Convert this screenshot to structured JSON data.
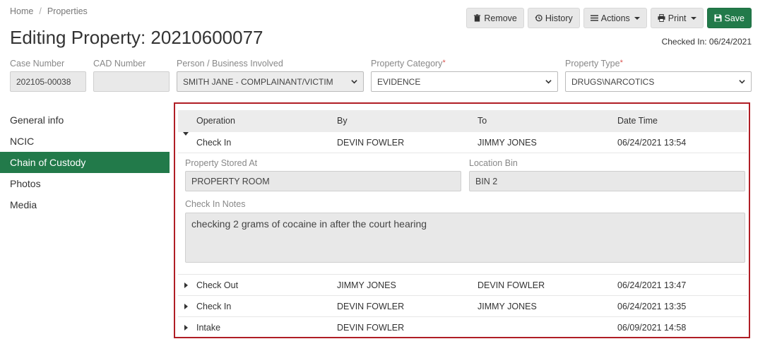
{
  "breadcrumb": {
    "home": "Home",
    "separator": "/",
    "current": "Properties"
  },
  "page": {
    "title": "Editing Property: 20210600077",
    "checked_in": "Checked In: 06/24/2021"
  },
  "toolbar": {
    "remove": "Remove",
    "history": "History",
    "actions": "Actions",
    "print": "Print",
    "save": "Save"
  },
  "fields": {
    "case_number": {
      "label": "Case Number",
      "value": "202105-00038"
    },
    "cad_number": {
      "label": "CAD Number",
      "value": ""
    },
    "person": {
      "label": "Person / Business Involved",
      "value": "SMITH JANE - COMPLAINANT/VICTIM"
    },
    "category": {
      "label": "Property Category",
      "required": "*",
      "value": "EVIDENCE"
    },
    "type": {
      "label": "Property Type",
      "required": "*",
      "value": "DRUGS\\NARCOTICS"
    }
  },
  "sidebar": {
    "items": [
      {
        "label": "General info"
      },
      {
        "label": "NCIC"
      },
      {
        "label": "Chain of Custody"
      },
      {
        "label": "Photos"
      },
      {
        "label": "Media"
      }
    ]
  },
  "custody": {
    "columns": {
      "operation": "Operation",
      "by": "By",
      "to": "To",
      "datetime": "Date Time"
    },
    "rows": [
      {
        "operation": "Check In",
        "by": "DEVIN FOWLER",
        "to": "JIMMY JONES",
        "datetime": "06/24/2021 13:54"
      },
      {
        "operation": "Check Out",
        "by": "JIMMY JONES",
        "to": "DEVIN FOWLER",
        "datetime": "06/24/2021 13:47"
      },
      {
        "operation": "Check In",
        "by": "DEVIN FOWLER",
        "to": "JIMMY JONES",
        "datetime": "06/24/2021 13:35"
      },
      {
        "operation": "Intake",
        "by": "DEVIN FOWLER",
        "to": "",
        "datetime": "06/09/2021 14:58"
      }
    ],
    "detail": {
      "stored_at_label": "Property Stored At",
      "stored_at": "PROPERTY ROOM",
      "bin_label": "Location Bin",
      "bin": "BIN 2",
      "notes_label": "Check In Notes",
      "notes": "checking 2 grams of cocaine in after the court hearing"
    }
  },
  "colors": {
    "primary": "#227a4a",
    "highlight_border": "#b01e25"
  }
}
